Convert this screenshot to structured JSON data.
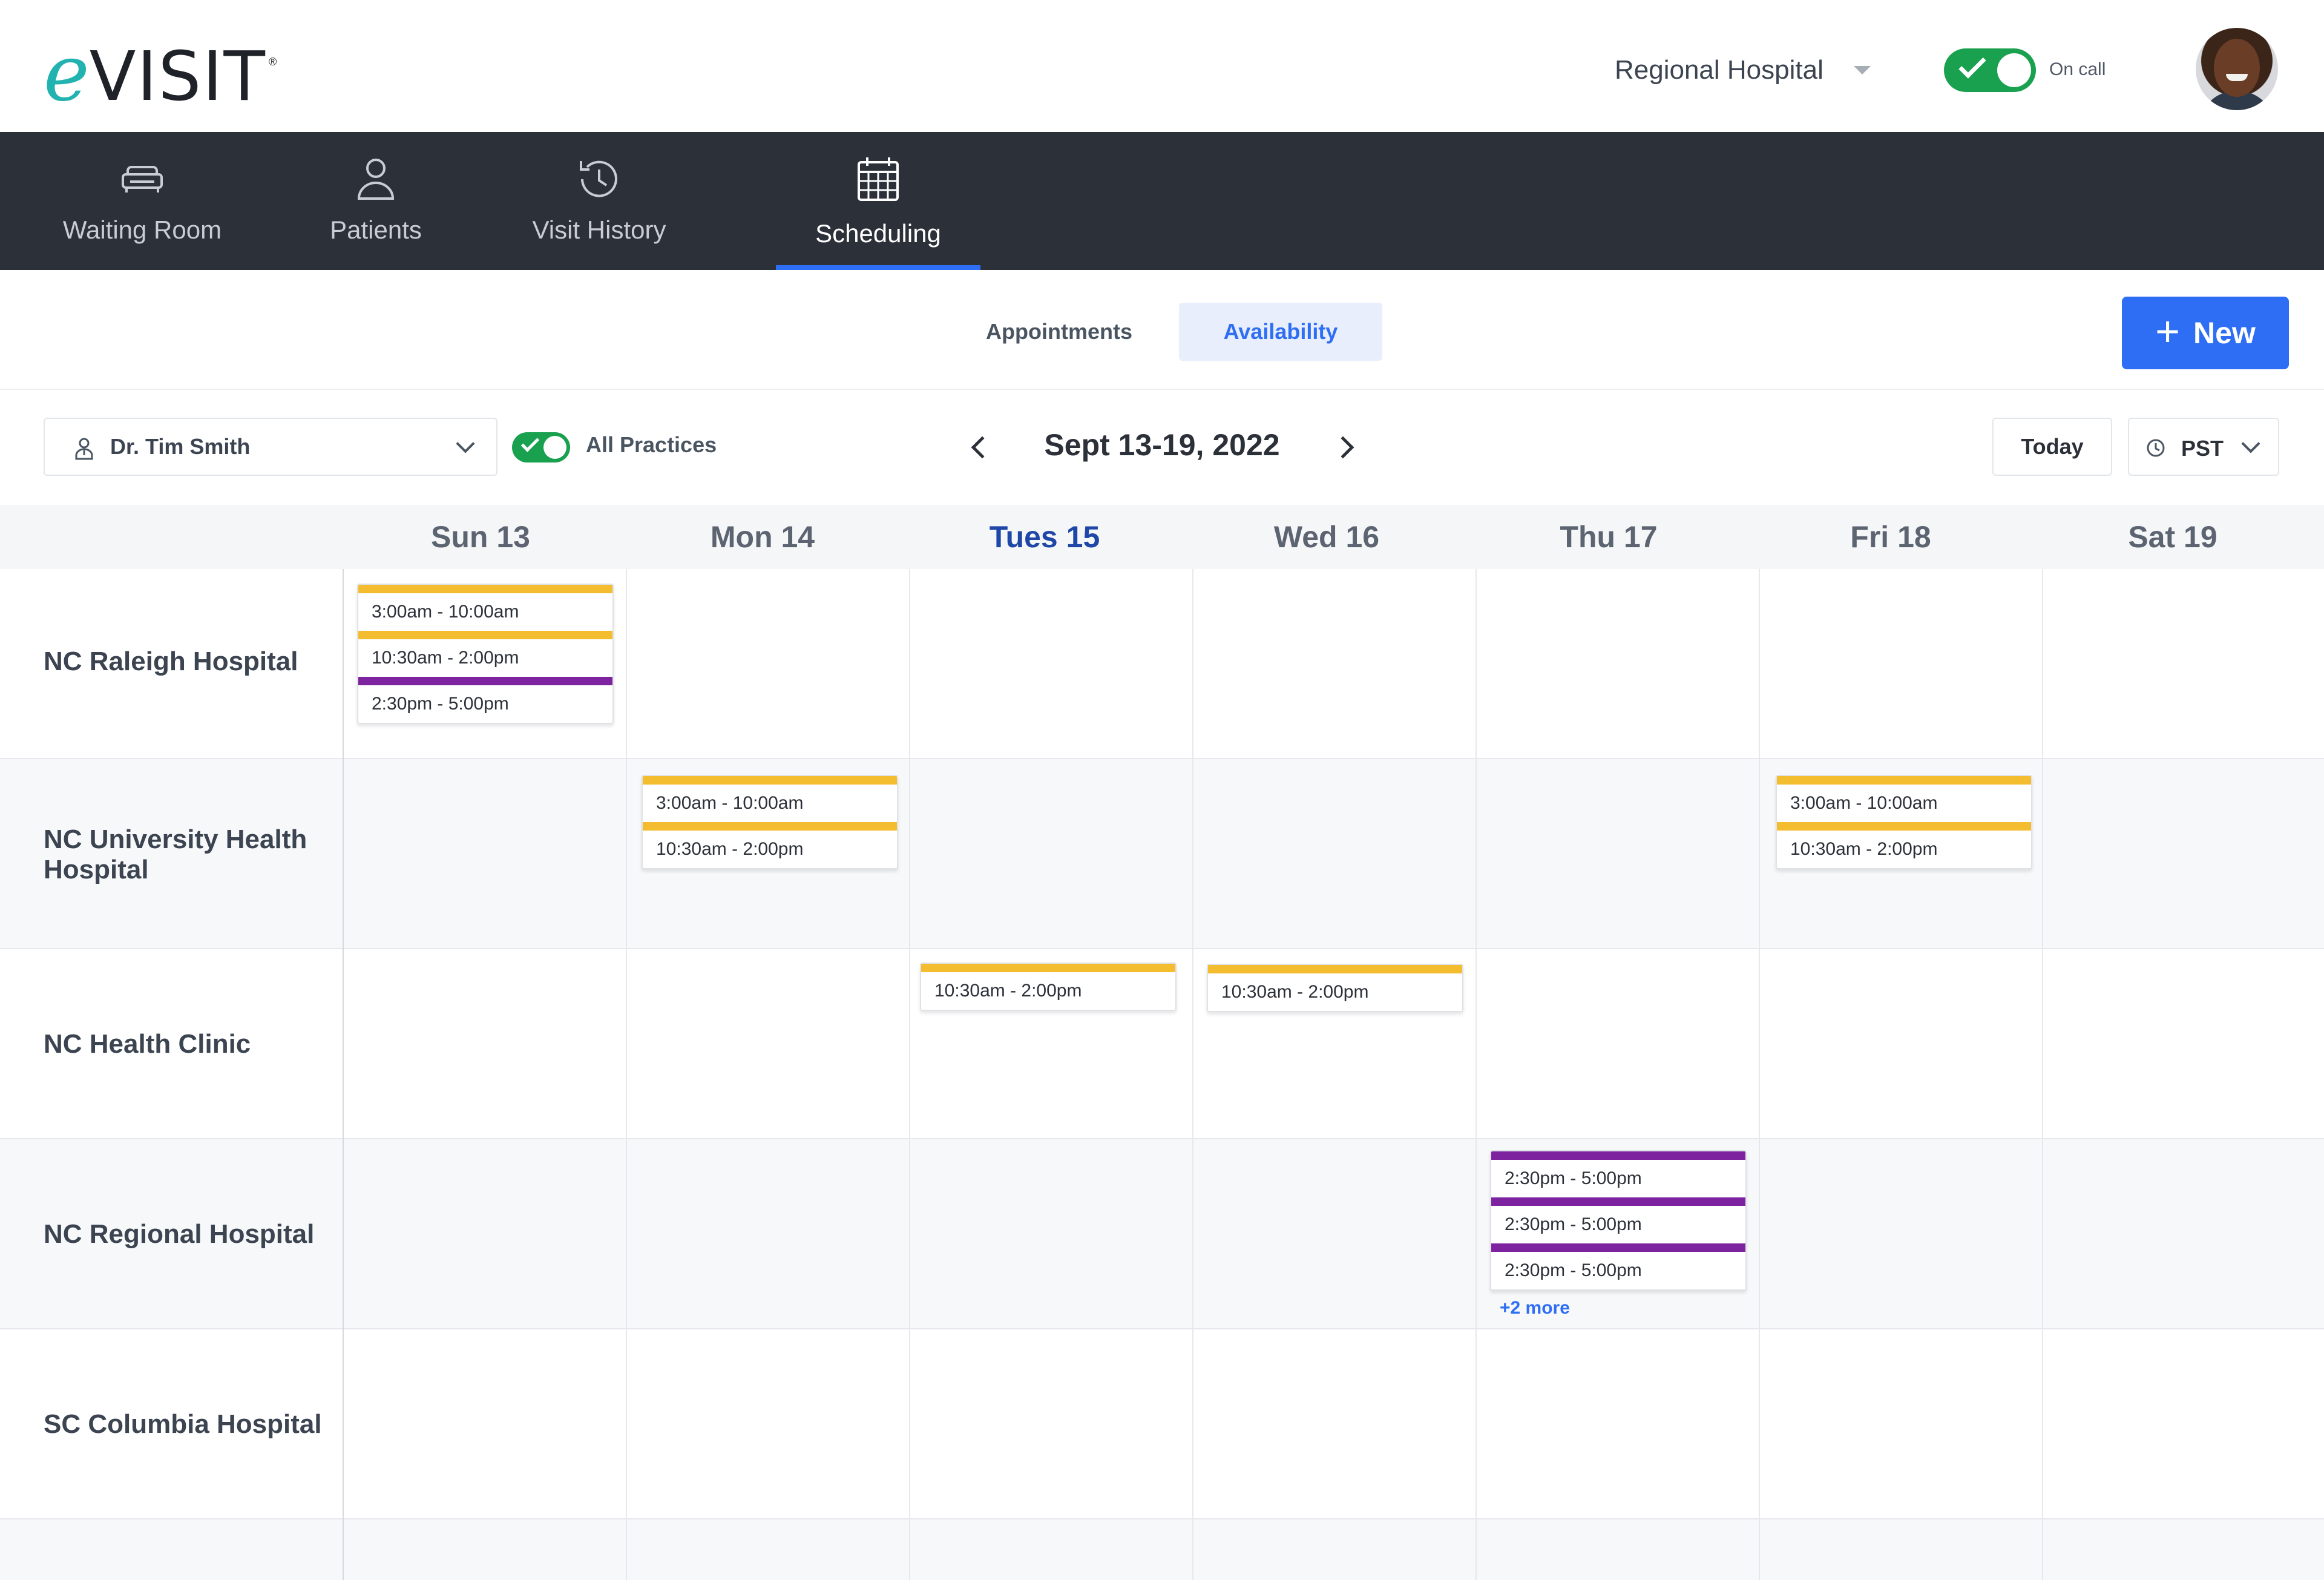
{
  "header": {
    "logo_e": "e",
    "logo_rest": "VISIT",
    "logo_reg": "®",
    "hospital": "Regional Hospital",
    "on_call_label": "On call"
  },
  "nav": {
    "items": [
      {
        "label": "Waiting Room",
        "icon": "couch-icon"
      },
      {
        "label": "Patients",
        "icon": "person-icon"
      },
      {
        "label": "Visit History",
        "icon": "history-icon"
      },
      {
        "label": "Scheduling",
        "icon": "calendar-icon",
        "active": true
      }
    ]
  },
  "subtabs": {
    "appointments": "Appointments",
    "availability": "Availability",
    "active": "availability"
  },
  "new_button": {
    "plus": "+",
    "label": "New"
  },
  "filters": {
    "provider": "Dr. Tim Smith",
    "all_practices_label": "All Practices",
    "date_range": "Sept 13-19, 2022",
    "today": "Today",
    "timezone": "PST"
  },
  "calendar": {
    "days": [
      "Sun 13",
      "Mon 14",
      "Tues 15",
      "Wed 16",
      "Thu 17",
      "Fri 18",
      "Sat 19"
    ],
    "today_index": 2,
    "locations": [
      "NC Raleigh Hospital",
      "NC University Health Hospital",
      "NC Health Clinic",
      "NC Regional Hospital",
      "SC Columbia Hospital"
    ],
    "slots": {
      "raleigh_sun": [
        {
          "time": "3:00am - 10:00am",
          "color": "#f4bd2f"
        },
        {
          "time": "10:30am - 2:00pm",
          "color": "#f4bd2f"
        },
        {
          "time": "2:30pm - 5:00pm",
          "color": "#7d23a0"
        }
      ],
      "university_mon": [
        {
          "time": "3:00am - 10:00am",
          "color": "#f4bd2f"
        },
        {
          "time": "10:30am - 2:00pm",
          "color": "#f4bd2f"
        }
      ],
      "university_fri": [
        {
          "time": "3:00am - 10:00am",
          "color": "#f4bd2f"
        },
        {
          "time": "10:30am - 2:00pm",
          "color": "#f4bd2f"
        }
      ],
      "clinic_tue": [
        {
          "time": "10:30am - 2:00pm",
          "color": "#f4bd2f"
        }
      ],
      "clinic_wed": [
        {
          "time": "10:30am - 2:00pm",
          "color": "#f4bd2f"
        }
      ],
      "regional_thu": [
        {
          "time": "2:30pm - 5:00pm",
          "color": "#7d23a0"
        },
        {
          "time": "2:30pm - 5:00pm",
          "color": "#7d23a0"
        },
        {
          "time": "2:30pm - 5:00pm",
          "color": "#7d23a0"
        }
      ],
      "regional_thu_more": "+2 more"
    }
  },
  "colors": {
    "accent": "#2e6ef5",
    "nav_bg": "#2c3038",
    "toggle_green": "#1aa14f",
    "slot_yellow": "#f4bd2f",
    "slot_purple": "#7d23a0"
  }
}
